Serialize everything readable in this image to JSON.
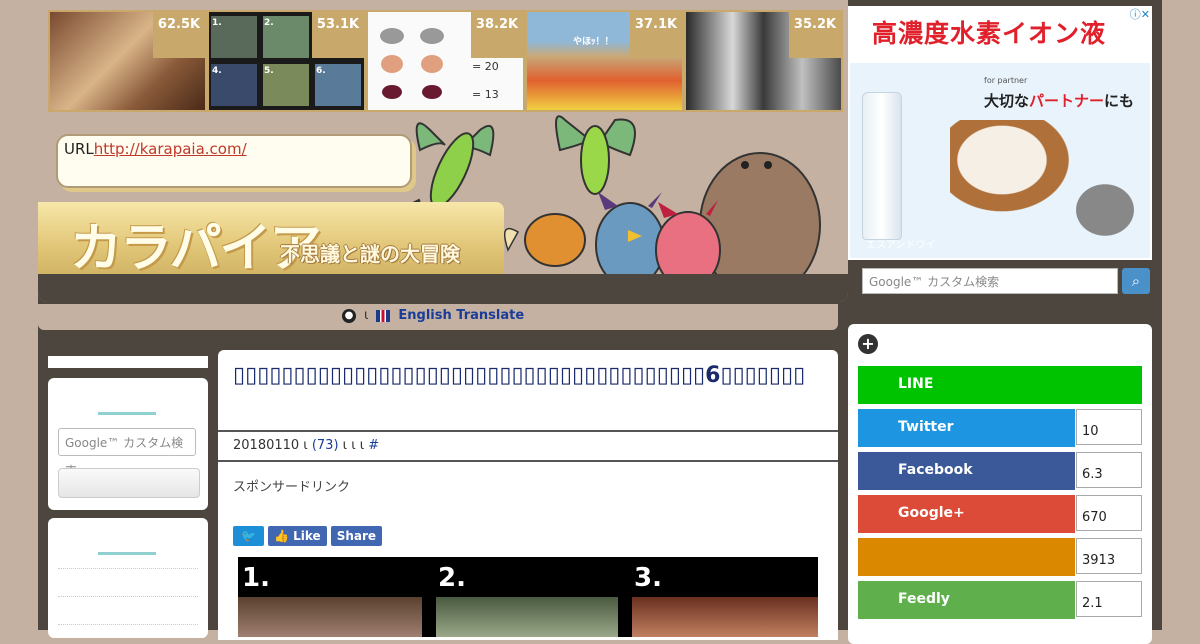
{
  "thumbnails": [
    {
      "count": "62.5K"
    },
    {
      "count": "53.1K",
      "panels": [
        "1.",
        "2.",
        "3.",
        "4.",
        "5.",
        "6."
      ]
    },
    {
      "count": "38.2K",
      "equations": [
        "= 20",
        "= 13"
      ]
    },
    {
      "count": "37.1K",
      "caption": "やほｯ！！"
    },
    {
      "count": "35.2K"
    }
  ],
  "header": {
    "url_prefix": "URL",
    "url_link": "http://karapaia.com/",
    "logo_text": "カラパイア",
    "tagline": "不思議と謎の大冒険"
  },
  "translate": {
    "separator": "ι",
    "label": "English Translate"
  },
  "left_sidebar": {
    "search_placeholder": "Google™ カスタム検索"
  },
  "article": {
    "title": "6",
    "meta_date": "20180110 ι",
    "meta_comments": "(73)",
    "meta_tail": "ι ι   ι",
    "meta_hash": "#",
    "sponsor_label": "スポンサードリンク",
    "share": {
      "tweet_icon": "twitter-bird-icon",
      "like": "Like",
      "share": "Share"
    },
    "image_panels": [
      "1.",
      "2.",
      "3."
    ]
  },
  "ad": {
    "title": "高濃度水素イオン液",
    "sub_prefix": "大切な",
    "sub_highlight": "パートナー",
    "sub_suffix": "にも",
    "partner_tag": "for partner",
    "brand": "エスアンドワイ",
    "choices_icon": "adchoices-icon"
  },
  "right_search": {
    "placeholder": "Google™ カスタム検索",
    "button_icon": "search-icon"
  },
  "social": [
    {
      "name": "LINE",
      "count": ""
    },
    {
      "name": "Twitter",
      "count": "10"
    },
    {
      "name": "Facebook",
      "count": "6.3"
    },
    {
      "name": "Google+",
      "count": "670"
    },
    {
      "name": "",
      "count": "3913"
    },
    {
      "name": "Feedly",
      "count": "2.1"
    }
  ],
  "colors": {
    "background": "#c4b1a1",
    "frame": "#4c463e",
    "gold": "#c9a96b",
    "title_navy": "#1a2a6c",
    "link_red": "#c0392b",
    "line_green": "#00c300",
    "twitter_blue": "#1d95e0",
    "facebook_blue": "#3b5998",
    "google_red": "#dc4a38",
    "hatena_orange": "#d98800",
    "feedly_green": "#5faf4d"
  }
}
